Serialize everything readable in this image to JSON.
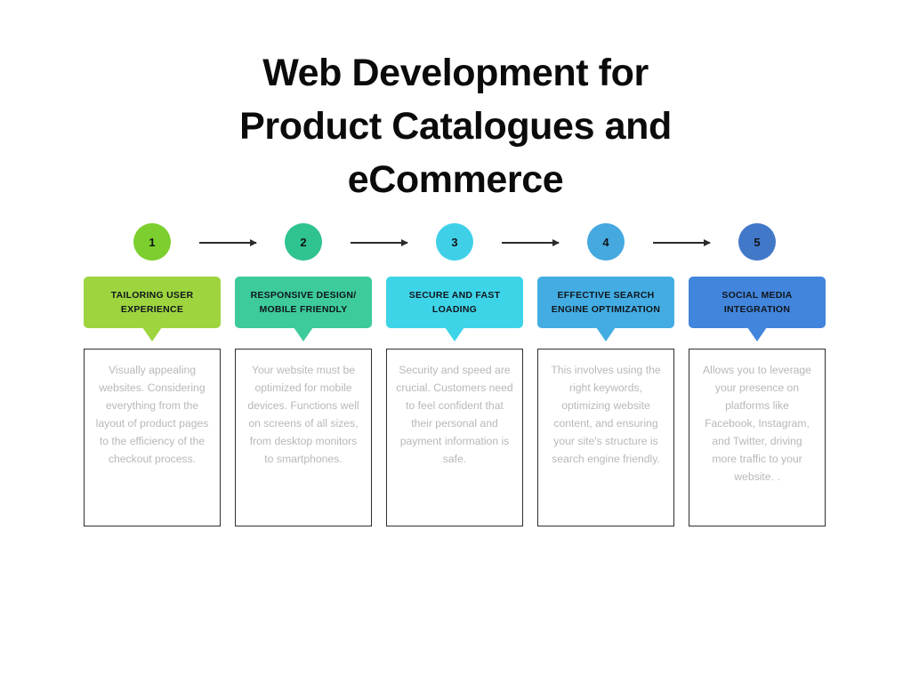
{
  "title": {
    "line1": "Web Development for",
    "line2": "Product Catalogues and",
    "line3": "eCommerce"
  },
  "colors": {
    "circle_1": "#7CCF2E",
    "circle_2": "#2FC38F",
    "circle_3": "#3FD0E8",
    "circle_4": "#45A9E0",
    "circle_5": "#4178C8",
    "box_1": "#9ED53F",
    "box_2": "#3DCB9B",
    "box_3": "#3ED4E8",
    "box_4": "#43ADE3",
    "box_5": "#4285DC",
    "arrow": "#2b2b2b",
    "body_text": "#b8b8b8",
    "body_border": "#2f2f2f",
    "title_text": "#0b0b0b",
    "header_text": "#10161d"
  },
  "steps": [
    {
      "number": "1",
      "header": "TAILORING USER EXPERIENCE",
      "body": "Visually appealing websites. Considering everything from the layout of product pages to the efficiency of the checkout process."
    },
    {
      "number": "2",
      "header": "RESPONSIVE DESIGN/ MOBILE FRIENDLY",
      "body": "Your website must be optimized for mobile devices. Functions well on screens of all sizes, from desktop monitors to smartphones."
    },
    {
      "number": "3",
      "header": "SECURE AND FAST LOADING",
      "body": "Security and speed are crucial. Customers need to feel confident that their personal and payment information is safe."
    },
    {
      "number": "4",
      "header": "EFFECTIVE SEARCH ENGINE OPTIMIZATION",
      "body": "This involves using the right keywords, optimizing website content, and ensuring your site's structure is search engine friendly."
    },
    {
      "number": "5",
      "header": "SOCIAL MEDIA INTEGRATION",
      "body": "Allows you to leverage your presence on platforms like Facebook, Instagram, and Twitter, driving more traffic to your website. ."
    }
  ],
  "arrows": [
    {
      "name": "arrow-1-to-2"
    },
    {
      "name": "arrow-2-to-3"
    },
    {
      "name": "arrow-3-to-4"
    },
    {
      "name": "arrow-4-to-5"
    }
  ]
}
